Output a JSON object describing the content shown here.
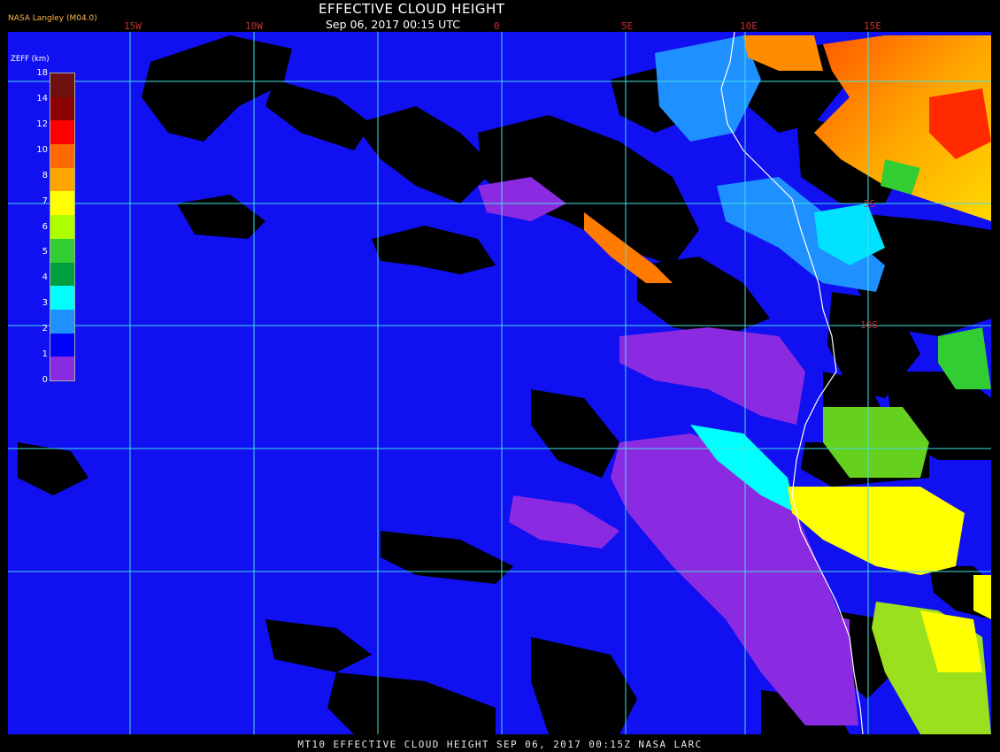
{
  "title": "EFFECTIVE CLOUD HEIGHT",
  "subtitle": "Sep 06, 2017 00:15 UTC",
  "producer": "NASA Langley (M04.0)",
  "footer": "MT10  EFFECTIVE CLOUD HEIGHT  SEP 06, 2017 00:15Z  NASA LARC",
  "legend": {
    "title": "ZEFF (km)",
    "ticks": [
      "18",
      "14",
      "12",
      "10",
      "8",
      "7",
      "6",
      "5",
      "4",
      "3",
      "2",
      "1",
      "0"
    ],
    "colors": [
      "#6e1010",
      "#8b0000",
      "#ff0000",
      "#ff6a00",
      "#ffa500",
      "#ffff00",
      "#b0ff00",
      "#32cd32",
      "#009e3e",
      "#00ffff",
      "#1e90ff",
      "#0000ff",
      "#8a2be2"
    ]
  },
  "grid": {
    "lon_labels": [
      "15W",
      "10W",
      "0",
      "5E",
      "10E",
      "15E"
    ],
    "lat_labels": [
      "5S",
      "10S"
    ],
    "line_color": "#44e0e0"
  },
  "colors": {
    "background": "#000000",
    "ocean_cloud": "#1010f0",
    "low_cloud": "#8a2be2",
    "coastline": "#ffffff"
  }
}
